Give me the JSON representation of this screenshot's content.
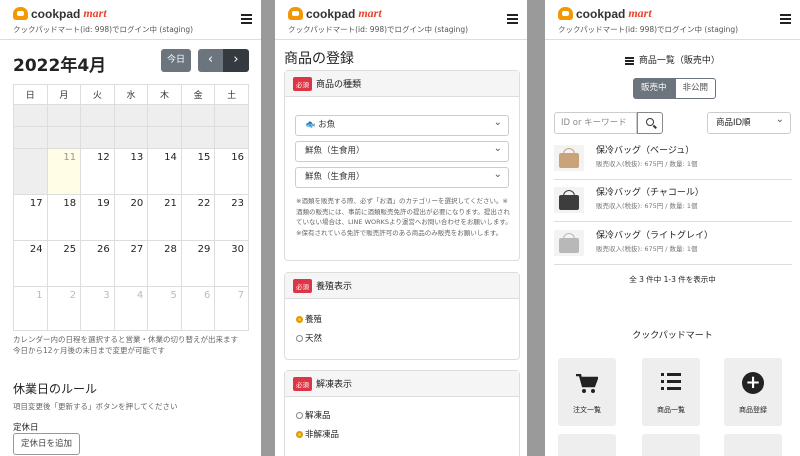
{
  "brand": {
    "name": "cookpad",
    "suffix": "mart",
    "accent": "#f39800",
    "mart_color": "#e8452c"
  },
  "panels": [
    {
      "user_line": "クックパッドマート(id: 998)でログイン中 (staging)",
      "calendar": {
        "title": "2022年4月",
        "today_label": "今日",
        "prev_icon": "‹",
        "next_icon": "›",
        "weekdays": [
          "日",
          "月",
          "火",
          "水",
          "木",
          "金",
          "土"
        ],
        "rows": [
          [
            "",
            "",
            "",
            "",
            "",
            "",
            ""
          ],
          [
            "",
            "",
            "",
            "",
            "",
            "",
            ""
          ],
          [
            "",
            "11",
            "12",
            "13",
            "14",
            "15",
            "16"
          ],
          [
            "17",
            "18",
            "19",
            "20",
            "21",
            "22",
            "23"
          ],
          [
            "24",
            "25",
            "26",
            "27",
            "28",
            "29",
            "30"
          ],
          [
            "1",
            "2",
            "3",
            "4",
            "5",
            "6",
            "7"
          ]
        ],
        "note_line1": "カレンダー内の日程を選択すると営業・休業の切り替えが出来ます",
        "note_line2": "今日から12ヶ月後の末日まで変更が可能です"
      },
      "holiday_rules": {
        "title": "休業日のルール",
        "desc": "項目変更後「更新する」ボタンを押してください",
        "label": "定休日",
        "add_button": "定休日を追加"
      }
    },
    {
      "user_line": "クックパッドマート(id: 998)でログイン中 (staging)",
      "page_title": "商品の登録",
      "required_badge": "必須",
      "type_card": {
        "title": "商品の種類",
        "select1": "🐟 お魚",
        "select2": "鮮魚（生食用）",
        "select3": "鮮魚（生食用）",
        "note": "※酒類を販売する際、必ず「お酒」のカテゴリーを選択してください。※酒類の販売には、事前に酒類販売免許の提出が必要になります。提出されていない場合は、LINE WORKSより運営へお問い合わせをお願いします。 ※保有されている免許で販売許可のある商品のみ販売をお願いします。"
      },
      "farming_card": {
        "title": "養殖表示",
        "options": [
          "養殖",
          "天然"
        ],
        "selected": "養殖"
      },
      "thaw_card": {
        "title": "解凍表示",
        "options": [
          "解凍品",
          "非解凍品"
        ],
        "selected": "非解凍品"
      }
    },
    {
      "user_line": "クックパッドマート(id: 998)でログイン中 (staging)",
      "list_title": "商品一覧（販売中）",
      "tabs": [
        "販売中",
        "非公開"
      ],
      "search_placeholder": "ID or キーワード",
      "sort_value": "商品ID順",
      "items": [
        {
          "name": "保冷バッグ（ベージュ）",
          "sub": "販売収入(税抜): 675円 / 数量: 1個",
          "color": "#c9a37a"
        },
        {
          "name": "保冷バッグ（チャコール）",
          "sub": "販売収入(税抜): 675円 / 数量: 1個",
          "color": "#3d3d3d"
        },
        {
          "name": "保冷バッグ（ライトグレイ）",
          "sub": "販売収入(税抜): 675円 / 数量: 1個",
          "color": "#b8b8b8"
        }
      ],
      "count_text": "全 3 件中 1-3 件を表示中",
      "footer_title": "クックパッドマート",
      "tiles": [
        "注文一覧",
        "商品一覧",
        "商品登録"
      ]
    }
  ]
}
